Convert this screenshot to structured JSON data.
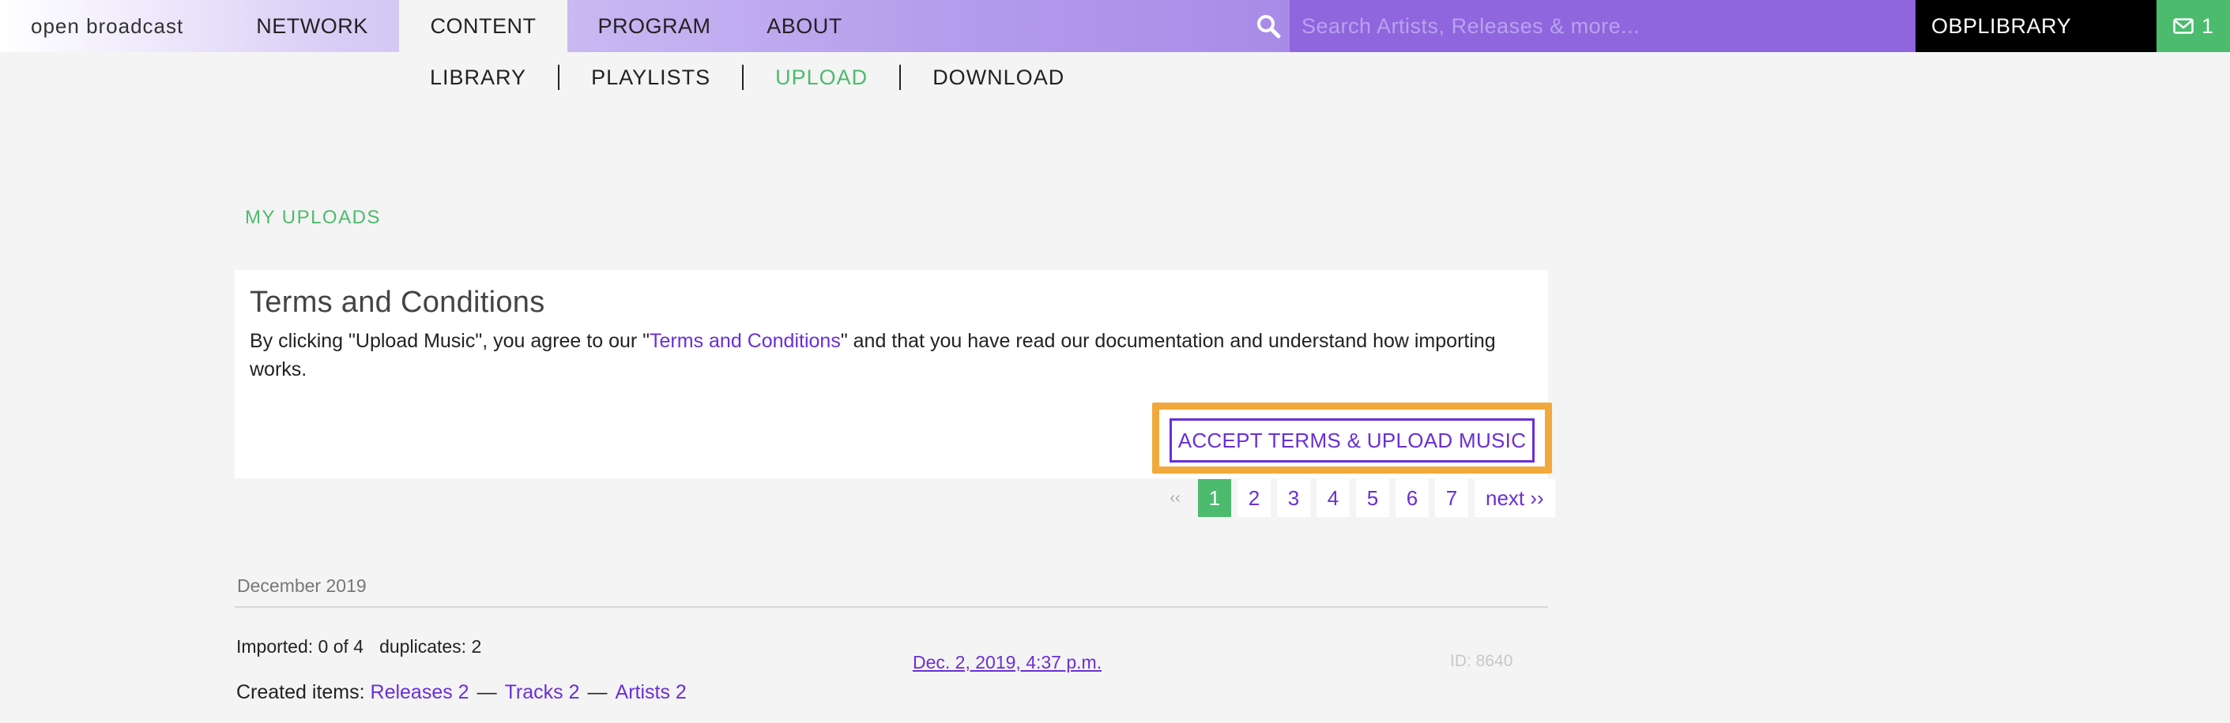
{
  "header": {
    "brand": "open broadcast",
    "nav": [
      "NETWORK",
      "CONTENT",
      "PROGRAM",
      "ABOUT"
    ],
    "active_nav": "CONTENT",
    "search_placeholder": "Search Artists, Releases & more...",
    "library_label": "OBPLIBRARY",
    "mail_count": "1"
  },
  "subnav": {
    "items": [
      "LIBRARY",
      "PLAYLISTS",
      "UPLOAD",
      "DOWNLOAD"
    ],
    "active": "UPLOAD"
  },
  "section_title": "MY UPLOADS",
  "terms": {
    "title": "Terms and Conditions",
    "text_before": "By clicking \"Upload Music\", you agree to our \"",
    "link_text": "Terms and Conditions",
    "text_after": "\" and that you have read our documentation and understand how importing works.",
    "button_label": "ACCEPT TERMS & UPLOAD MUSIC"
  },
  "pagination": {
    "prev": "‹‹",
    "pages": [
      "1",
      "2",
      "3",
      "4",
      "5",
      "6",
      "7"
    ],
    "current": "1",
    "next": "next ››"
  },
  "uploads": {
    "month": "December 2019",
    "items": [
      {
        "imported": "Imported: 0 of 4",
        "duplicates": "duplicates: 2",
        "date": "Dec. 2, 2019, 4:37 p.m.",
        "id": "ID: 8640",
        "created_label": "Created items:",
        "releases": "Releases 2",
        "tracks": "Tracks 2",
        "artists": "Artists 2",
        "separator": "—"
      }
    ]
  },
  "colors": {
    "accent_purple": "#6a2fd6",
    "accent_green": "#4cbb6e",
    "highlight_orange": "#f2a93b"
  }
}
